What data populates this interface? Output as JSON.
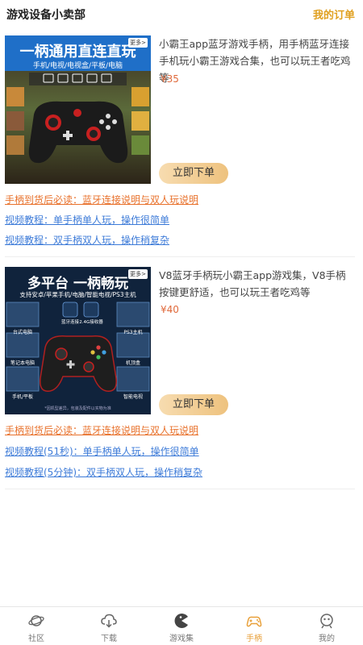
{
  "header": {
    "title": "游戏设备小卖部",
    "orders_link": "我的订单"
  },
  "products": [
    {
      "image": {
        "headline": "一柄通用直连直玩",
        "subline": "手机/电视/电视盒/平板/电脑",
        "more_tag": "更多>"
      },
      "description": "小霸王app蓝牙游戏手柄，用手柄蓝牙连接手机玩小霸王游戏合集，也可以玩王者吃鸡等",
      "price": "¥35",
      "buy_label": "立即下单",
      "links": [
        "手柄到货后必读：蓝牙连接说明与双人玩说明",
        "视频教程：单手柄单人玩，操作很简单",
        "视频教程：双手柄双人玩，操作稍复杂"
      ]
    },
    {
      "image": {
        "headline": "多平台 一柄畅玩",
        "subline": "支持安卓/苹果手机/电脑/智能电视/PS3主机",
        "more_tag": "更多>",
        "labels": [
          "台式电脑",
          "笔记本电脑",
          "手机/平板",
          "PS3主机",
          "机顶盒",
          "智能电视"
        ],
        "center_labels": [
          "蓝牙连接",
          "2.4G接收器"
        ],
        "footnote": "*因机型差异，包装及配件以实物为准"
      },
      "description": "V8蓝牙手柄玩小霸王app游戏集，V8手柄按键更舒适，也可以玩王者吃鸡等",
      "price": "¥40",
      "buy_label": "立即下单",
      "links": [
        "手柄到货后必读：蓝牙连接说明与双人玩说明",
        "视频教程(51秒)：单手柄单人玩，操作很简单",
        "视频教程(5分钟)：双手柄双人玩，操作稍复杂"
      ]
    }
  ],
  "tabs": [
    {
      "label": "社区",
      "icon": "planet-icon"
    },
    {
      "label": "下载",
      "icon": "cloud-download-icon"
    },
    {
      "label": "游戏集",
      "icon": "pacman-icon"
    },
    {
      "label": "手柄",
      "icon": "gamepad-icon",
      "active": true
    },
    {
      "label": "我的",
      "icon": "profile-icon"
    }
  ],
  "colors": {
    "accent": "#e8a03a",
    "price": "#e06a3c",
    "link_orange": "#e8702a",
    "link_blue": "#3d7bd8"
  }
}
